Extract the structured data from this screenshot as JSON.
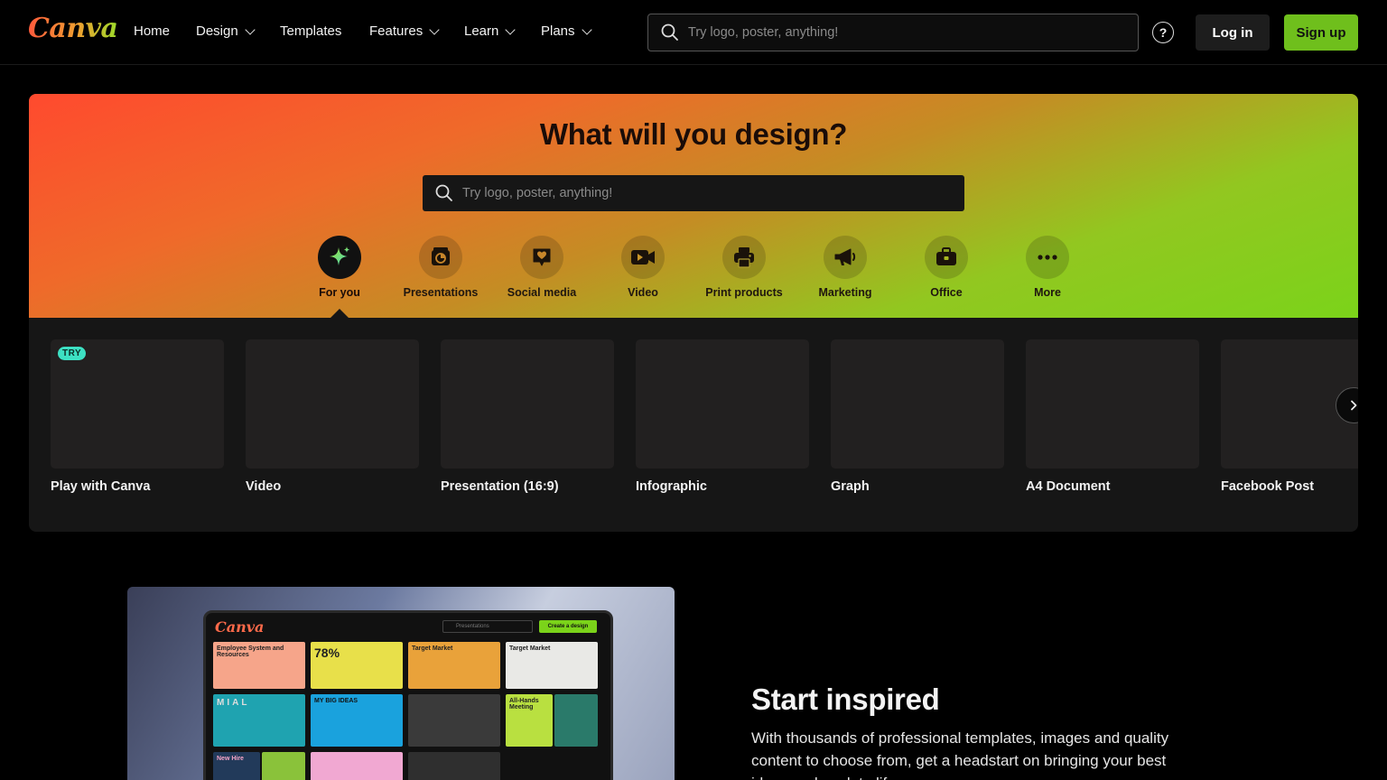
{
  "brand": {
    "logo_text": "Canva"
  },
  "nav": {
    "items": [
      {
        "label": "Home",
        "dropdown": false
      },
      {
        "label": "Design",
        "dropdown": true
      },
      {
        "label": "Templates",
        "dropdown": false
      },
      {
        "label": "Features",
        "dropdown": true
      },
      {
        "label": "Learn",
        "dropdown": true
      },
      {
        "label": "Plans",
        "dropdown": true
      }
    ],
    "search_placeholder": "Try logo, poster, anything!",
    "help_icon": "?",
    "login_label": "Log in",
    "signup_label": "Sign up"
  },
  "hero": {
    "title": "What will you design?",
    "search_placeholder": "Try logo, poster, anything!",
    "categories": [
      {
        "label": "For you",
        "icon": "sparkle-icon",
        "active": true
      },
      {
        "label": "Presentations",
        "icon": "presentation-icon",
        "active": false
      },
      {
        "label": "Social media",
        "icon": "heart-chat-icon",
        "active": false
      },
      {
        "label": "Video",
        "icon": "video-camera-icon",
        "active": false
      },
      {
        "label": "Print products",
        "icon": "printer-icon",
        "active": false
      },
      {
        "label": "Marketing",
        "icon": "megaphone-icon",
        "active": false
      },
      {
        "label": "Office",
        "icon": "briefcase-icon",
        "active": false
      },
      {
        "label": "More",
        "icon": "more-dots-icon",
        "active": false
      }
    ]
  },
  "cards": [
    {
      "label": "Play with Canva",
      "badge": "TRY"
    },
    {
      "label": "Video"
    },
    {
      "label": "Presentation (16:9)"
    },
    {
      "label": "Infographic"
    },
    {
      "label": "Graph"
    },
    {
      "label": "A4 Document"
    },
    {
      "label": "Facebook Post"
    }
  ],
  "inspired": {
    "title": "Start inspired",
    "description": "With thousands of professional templates, images and quality content to choose from, get a headstart on bringing your best ideas and work to life.",
    "mock": {
      "logo": "Canva",
      "search": "Presentations",
      "create": "Create a design",
      "tiles": [
        "Employee System and Resources",
        "78%",
        "Target Market",
        "Target Market",
        "MIAL",
        "MY BIG IDEAS",
        "",
        "",
        "All-Hands Meeting",
        "",
        "New Hire",
        "",
        "",
        ""
      ]
    }
  },
  "colors": {
    "accent_green": "#6fbf1c",
    "try_badge": "#3de0c3",
    "hero_gradient_start": "#ff4a2e",
    "hero_gradient_end": "#7bd31a"
  }
}
